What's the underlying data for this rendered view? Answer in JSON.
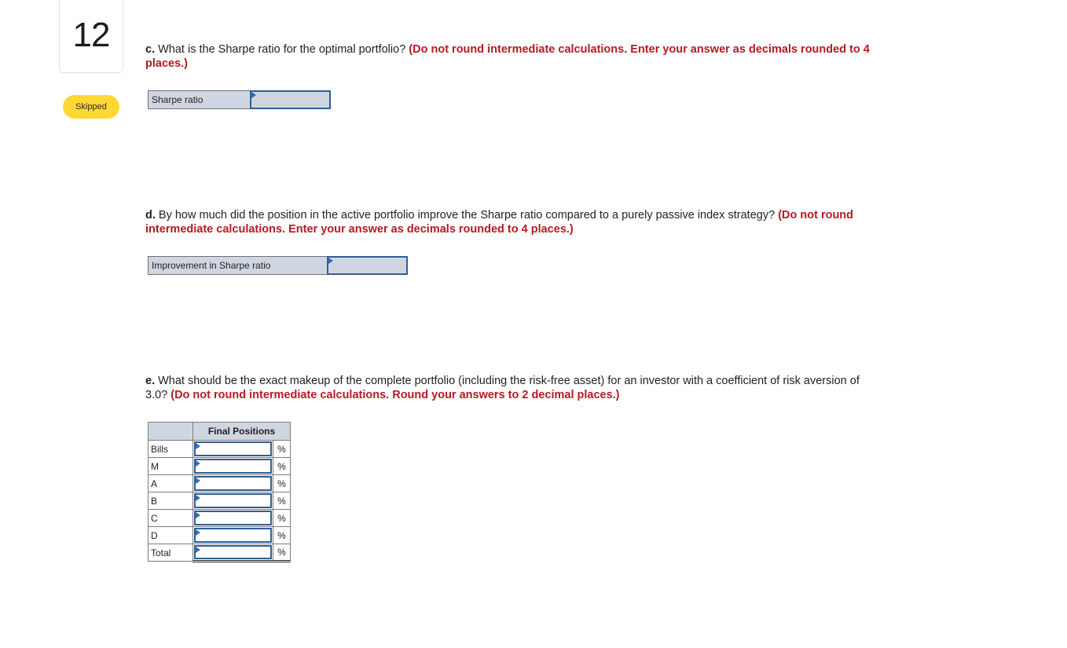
{
  "question": {
    "number": "12",
    "status": "Skipped"
  },
  "part_c": {
    "part_label": "c.",
    "text": " What is the Sharpe ratio for the optimal portfolio? ",
    "instruction": "(Do not round intermediate calculations. Enter your answer as decimals rounded to 4 places.)",
    "field_label": "Sharpe ratio",
    "field_value": ""
  },
  "part_d": {
    "part_label": "d.",
    "text": " By how much did the position in the active portfolio improve the Sharpe ratio compared to a purely passive index strategy? ",
    "instruction": "(Do not round intermediate calculations. Enter your answer as decimals rounded to 4 places.)",
    "field_label": "Improvement in Sharpe ratio",
    "field_value": ""
  },
  "part_e": {
    "part_label": "e.",
    "text": " What should be the exact makeup of the complete portfolio (including the risk-free asset) for an investor with a coefficient of risk aversion of 3.0? ",
    "instruction": "(Do not round intermediate calculations. Round your answers to 2 decimal places.)",
    "table": {
      "header": "Final Positions",
      "unit": "%",
      "rows": [
        {
          "label": "Bills",
          "value": ""
        },
        {
          "label": "M",
          "value": ""
        },
        {
          "label": "A",
          "value": ""
        },
        {
          "label": "B",
          "value": ""
        },
        {
          "label": "C",
          "value": ""
        },
        {
          "label": "D",
          "value": ""
        },
        {
          "label": "Total",
          "value": ""
        }
      ]
    }
  },
  "colors": {
    "instruction_red": "#b51a23",
    "badge_yellow": "#fdd835",
    "input_border_blue": "#2f5f94",
    "label_bg": "#d0d6e1"
  }
}
